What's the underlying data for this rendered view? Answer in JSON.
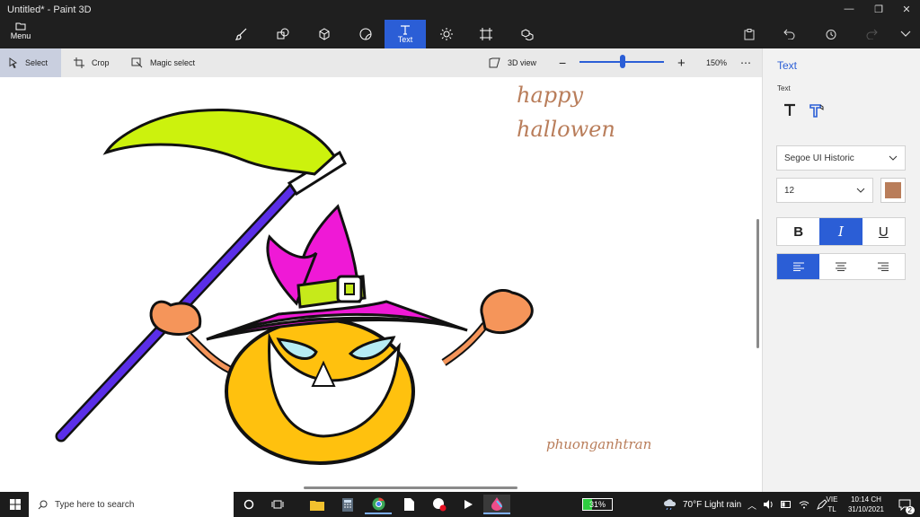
{
  "window": {
    "title": "Untitled* - Paint 3D"
  },
  "ribbon": {
    "menu_label": "Menu",
    "tools": [
      {
        "name": "brushes",
        "icon": "brush-icon",
        "label": ""
      },
      {
        "name": "2d-shapes",
        "icon": "2d-shapes-icon",
        "label": ""
      },
      {
        "name": "3d-shapes",
        "icon": "cube-icon",
        "label": ""
      },
      {
        "name": "stickers",
        "icon": "sticker-icon",
        "label": ""
      },
      {
        "name": "text",
        "icon": "text-icon",
        "label": "Text",
        "active": true
      },
      {
        "name": "effects",
        "icon": "sun-icon",
        "label": ""
      },
      {
        "name": "canvas",
        "icon": "canvas-icon",
        "label": ""
      },
      {
        "name": "3d-library",
        "icon": "3d-library-icon",
        "label": ""
      }
    ]
  },
  "subbar": {
    "select_label": "Select",
    "crop_label": "Crop",
    "magic_select_label": "Magic select",
    "view3d_label": "3D view",
    "zoom_label": "150%",
    "zoom_fraction": 0.5
  },
  "canvas": {
    "texts": [
      "happy",
      "hallowen",
      "phuonganhtran"
    ],
    "text_color": "#b97d5a"
  },
  "panel": {
    "title": "Text",
    "subtitle": "Text",
    "font_name": "Segoe UI Historic",
    "font_size": "12",
    "color": "#b97d5a",
    "bold_label": "B",
    "italic_label": "I",
    "underline_label": "U",
    "italic_on": true,
    "align": "left"
  },
  "taskbar": {
    "search_placeholder": "Type here to search",
    "battery": "31%",
    "weather": "70°F  Light rain",
    "lang_top": "VIE",
    "lang_bottom": "TL",
    "time": "10:14 CH",
    "date": "31/10/2021",
    "notifications": "2"
  },
  "colors": {
    "accent": "#2b5ed6",
    "dark_bar": "#1f1f1f",
    "taskbar": "#1c1c1c"
  }
}
